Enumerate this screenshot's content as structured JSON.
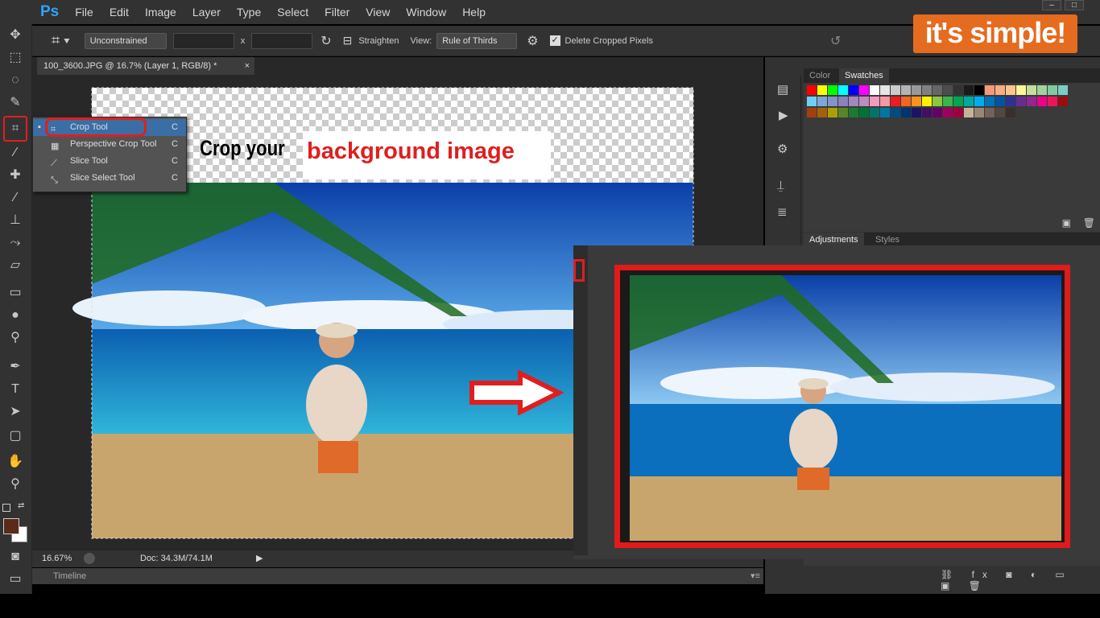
{
  "app": {
    "logo": "Ps",
    "menu": [
      "File",
      "Edit",
      "Image",
      "Layer",
      "Type",
      "Select",
      "Filter",
      "View",
      "Window",
      "Help"
    ]
  },
  "window_controls": [
    "–",
    "□"
  ],
  "options_bar": {
    "ratio": "Unconstrained",
    "x_sep": "x",
    "straighten": "Straighten",
    "view_label": "View:",
    "view_value": "Rule of Thirds",
    "delete_cropped": "Delete Cropped Pixels",
    "delete_cropped_checked": true
  },
  "document": {
    "tab": "100_3600.JPG @ 16.7% (Layer 1, RGB/8) *",
    "zoom": "16.67%",
    "doc_info": "Doc: 34.3M/74.1M",
    "timeline": "Timeline"
  },
  "flyout": {
    "items": [
      {
        "label": "Crop Tool",
        "key": "C",
        "selected": true
      },
      {
        "label": "Perspective Crop Tool",
        "key": "C"
      },
      {
        "label": "Slice Tool",
        "key": "C"
      },
      {
        "label": "Slice Select Tool",
        "key": "C"
      }
    ]
  },
  "panels": {
    "color_tabs": [
      "Color",
      "Swatches"
    ],
    "adj_tabs": [
      "Adjustments",
      "Styles"
    ]
  },
  "overlay": {
    "callout_black": "Crop your",
    "callout_red": "background image"
  },
  "brand": "it's simple!",
  "colors": {
    "highlight": "#e01e1e",
    "brand": "#e56b1f",
    "ps_blue": "#2ea4ff"
  }
}
